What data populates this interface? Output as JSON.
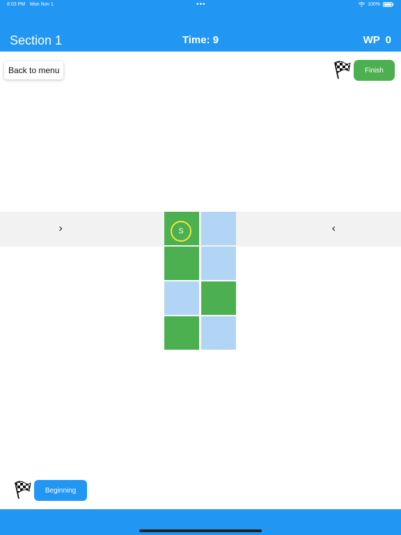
{
  "status_bar": {
    "time": "8:03 PM",
    "date": "Mon Nov 1",
    "dots": "•••",
    "battery": "100%"
  },
  "header": {
    "section": "Section 1",
    "time": "Time: 9",
    "wp": "WP  0"
  },
  "controls": {
    "back_label": "Back to menu",
    "finish_label": "Finish",
    "beginning_label": "Beginning"
  },
  "arrows": {
    "right": "›",
    "left": "‹"
  },
  "grid": {
    "columns": 2,
    "rows": 4,
    "cells": [
      [
        "green",
        "blue"
      ],
      [
        "green",
        "blue"
      ],
      [
        "blue",
        "green"
      ],
      [
        "green",
        "blue"
      ]
    ],
    "start_label": "S"
  },
  "icons": {
    "flag": "checkered-flag",
    "wifi": "wifi",
    "battery": "battery"
  },
  "colors": {
    "primary": "#2196F3",
    "success": "#4CAF50",
    "tile_blue": "#B3D5F5",
    "marker": "#F5E63A"
  }
}
